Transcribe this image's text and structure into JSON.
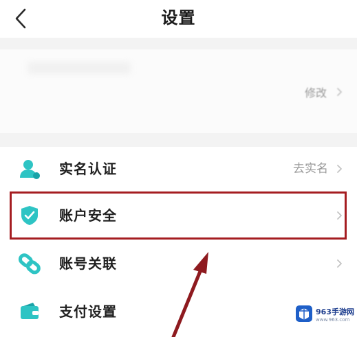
{
  "header": {
    "title": "设置",
    "back_icon": "chevron-left-icon"
  },
  "profile": {
    "edit_label": "修改"
  },
  "menu": {
    "items": [
      {
        "label": "实名认证",
        "value": "去实名",
        "icon": "user-verify-icon",
        "color": "#2ec4c4"
      },
      {
        "label": "账户安全",
        "value": "",
        "icon": "shield-icon",
        "color": "#2ec4c4"
      },
      {
        "label": "账号关联",
        "value": "",
        "icon": "link-icon",
        "color": "#2ec4c4"
      },
      {
        "label": "支付设置",
        "value": "",
        "icon": "wallet-icon",
        "color": "#2ec4c4"
      }
    ]
  },
  "annotation": {
    "highlight_color": "#a51d21",
    "arrow_color": "#8e1a1f"
  },
  "watermark": {
    "name": "963手游网",
    "url": "www.963.com"
  }
}
